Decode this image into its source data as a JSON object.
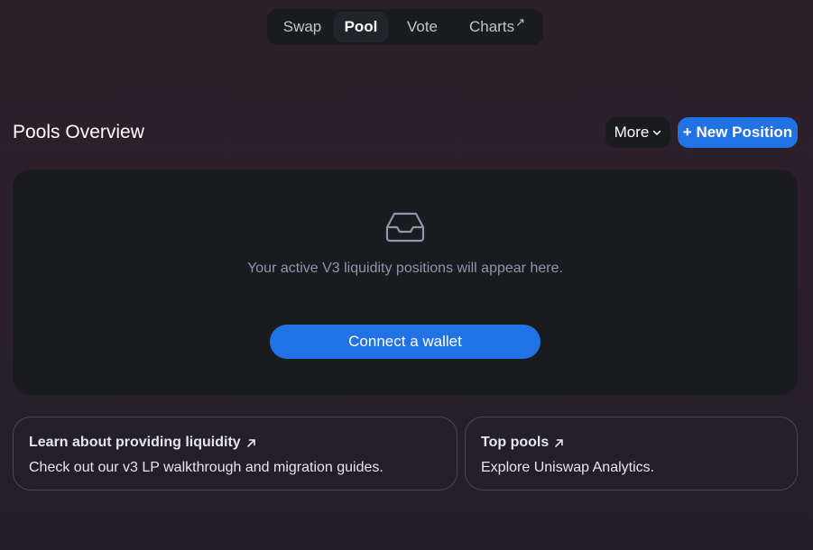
{
  "nav": {
    "tabs": [
      {
        "label": "Swap"
      },
      {
        "label": "Pool",
        "active": true
      },
      {
        "label": "Vote"
      },
      {
        "label": "Charts",
        "external": true
      }
    ]
  },
  "header": {
    "title": "Pools Overview",
    "more_label": "More",
    "new_position_label": "+ New Position"
  },
  "positions": {
    "empty_text": "Your active V3 liquidity positions will appear here.",
    "connect_label": "Connect a wallet",
    "icon": "inbox-icon"
  },
  "info_cards": [
    {
      "title": "Learn about providing liquidity",
      "description": "Check out our v3 LP walkthrough and migration guides."
    },
    {
      "title": "Top pools",
      "description": "Explore Uniswap Analytics."
    }
  ],
  "colors": {
    "accent": "#2172e5",
    "surface": "#191b1f",
    "muted_text": "#8f96ac"
  }
}
